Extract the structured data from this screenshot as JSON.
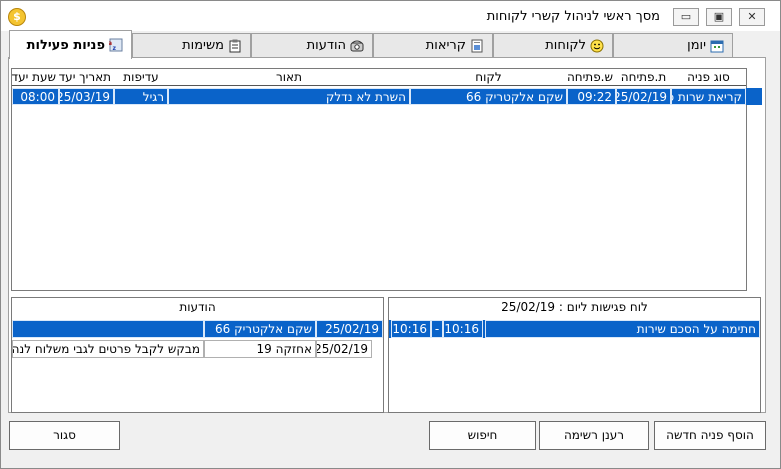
{
  "window": {
    "title": "מסך ראשי לניהול קשרי לקוחות",
    "app_icon_glyph": "$",
    "minimize_glyph": "▭",
    "maximize_glyph": "▣",
    "close_glyph": "✕"
  },
  "tabs": [
    {
      "label": "יומן",
      "icon": "calendar-icon"
    },
    {
      "label": "לקוחות",
      "icon": "smiley-icon"
    },
    {
      "label": "קריאות",
      "icon": "document-icon"
    },
    {
      "label": "הודעות",
      "icon": "phone-icon"
    },
    {
      "label": "משימות",
      "icon": "clipboard-icon"
    },
    {
      "label": "פניות פעילות",
      "icon": "sort-az-icon",
      "active": true
    }
  ],
  "main_table": {
    "headers": {
      "type": "סוג פניה",
      "open_date": "ת.פתיחה",
      "open_time": "ש.פתיחה",
      "customer": "לקוח",
      "description": "תאור",
      "priority": "עדיפות",
      "due_date": "תאריך יעד",
      "due_time": "שעת יעד"
    },
    "rows": [
      {
        "type": "קריאת שרות כנ",
        "open_date": "25/02/19",
        "open_time": "09:22",
        "customer": "שקם אלקטריק 66",
        "description": "השרת לא נדלק",
        "priority": "רגיל",
        "due_date": "25/03/19",
        "due_time": "08:00"
      }
    ]
  },
  "messages": {
    "title": "הודעות",
    "rows": [
      {
        "date": "25/02/19",
        "from": "שקם אלקטריק 66",
        "text": ""
      },
      {
        "date": "25/02/19",
        "from": "אחזקה 19",
        "text": "מבקש לקבל פרטים לגבי משלוח לנהריה"
      }
    ]
  },
  "meetings": {
    "title": "לוח פגישות ליום : 25/02/19",
    "rows": [
      {
        "subject": "חתימה על הסכם שירות",
        "start": "10:16",
        "sep": "-",
        "end": "10:16"
      }
    ]
  },
  "buttons": {
    "close": "סגור",
    "search": "חיפוש",
    "refresh": "רענן רשימה",
    "add": "הוסף פניה חדשה"
  },
  "colors": {
    "selection": "#0a63c9",
    "window_bg": "#f0f0f0"
  }
}
